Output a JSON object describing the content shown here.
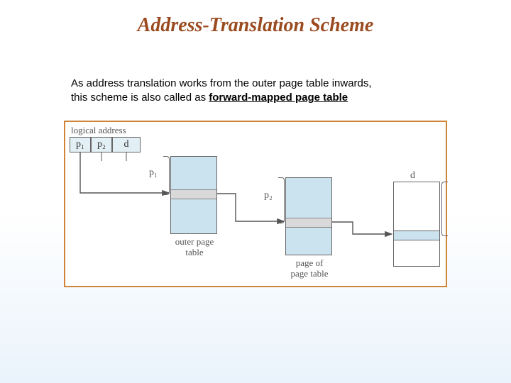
{
  "title": "Address-Translation Scheme",
  "body": {
    "line1": "As address translation works from the outer page table inwards,",
    "line2_pre": "this scheme is also called as ",
    "line2_bold": "forward-mapped page table"
  },
  "diagram": {
    "logical_address_label": "logical address",
    "fields": {
      "p1": "p₁",
      "p2": "p₂",
      "d": "d"
    },
    "seg_labels": {
      "p1": "p₁",
      "p2": "p₂",
      "d": "d"
    },
    "captions": {
      "outer": "outer page\ntable",
      "page_of": "page of\npage table"
    }
  }
}
